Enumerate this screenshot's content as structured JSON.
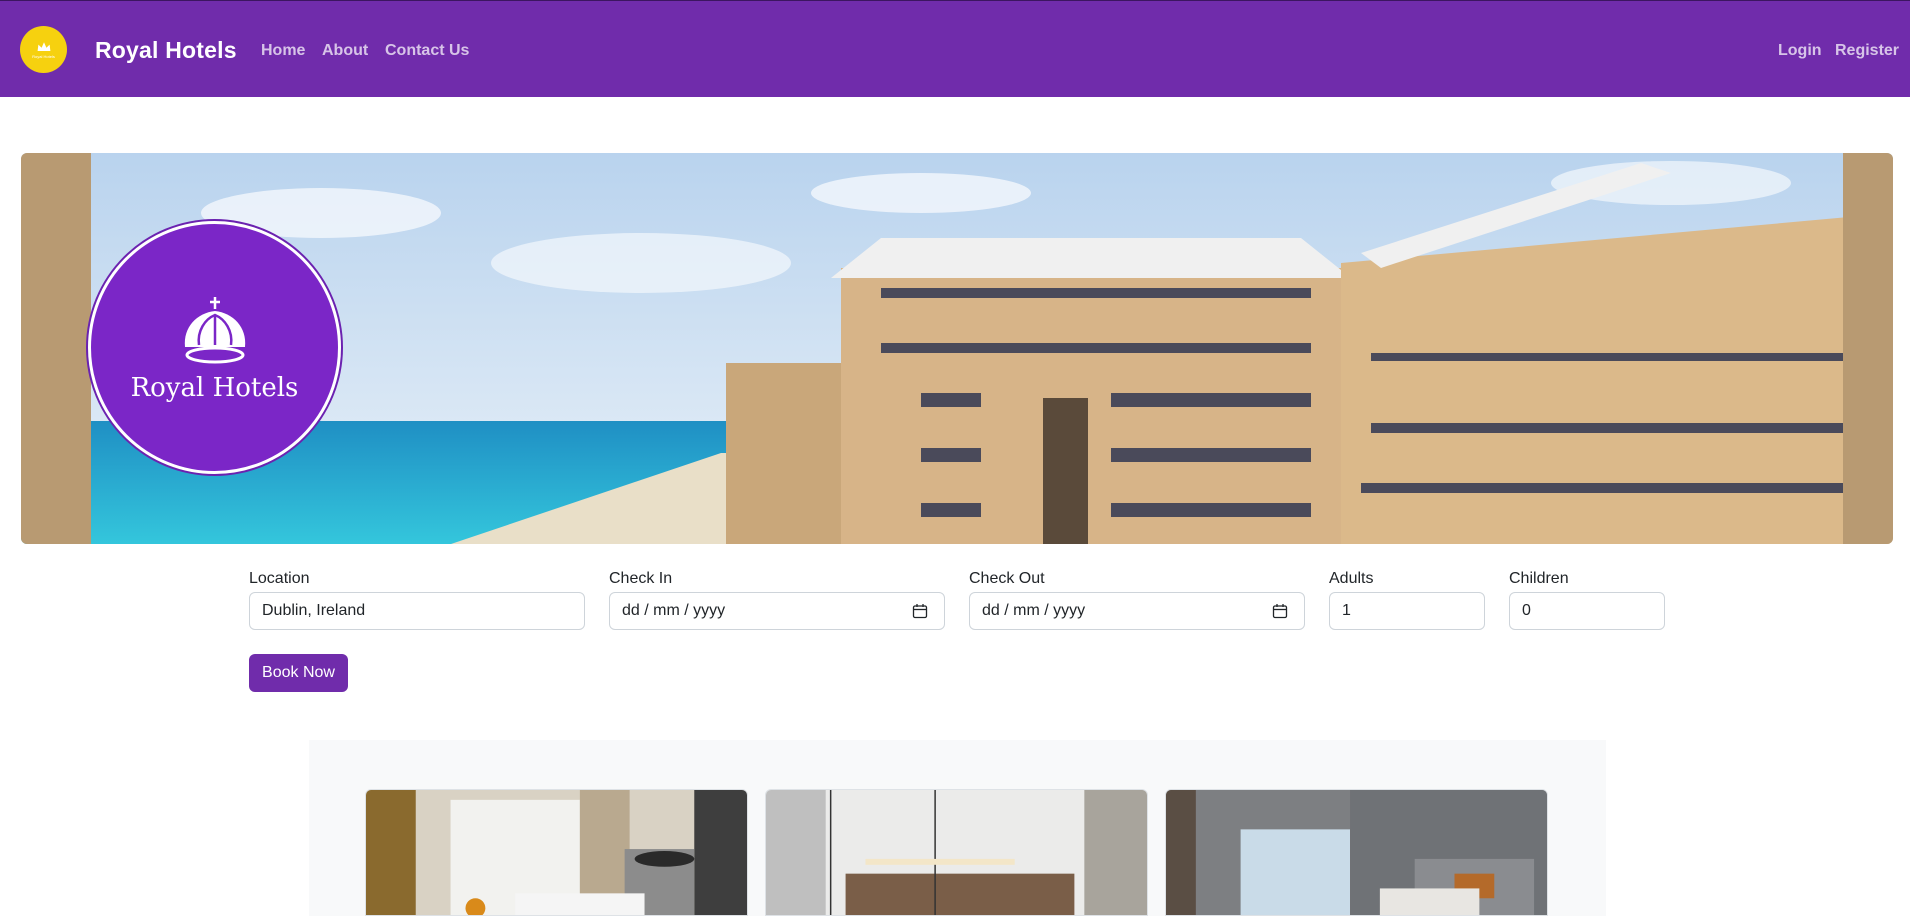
{
  "nav": {
    "logo_text": "Royal Hotels",
    "brand": "Royal Hotels",
    "links": [
      "Home",
      "About",
      "Contact Us"
    ],
    "auth": [
      "Login",
      "Register"
    ]
  },
  "hero": {
    "badge_text": "Royal Hotels"
  },
  "booking": {
    "location": {
      "label": "Location",
      "value": "Dublin, Ireland"
    },
    "check_in": {
      "label": "Check In",
      "placeholder": "dd / mm / yyyy"
    },
    "check_out": {
      "label": "Check Out",
      "placeholder": "dd / mm / yyyy"
    },
    "adults": {
      "label": "Adults",
      "value": "1"
    },
    "children": {
      "label": "Children",
      "value": "0"
    },
    "submit": "Book Now"
  },
  "colors": {
    "primary": "#702cab",
    "logo_yellow": "#f6d10f",
    "badge_purple": "#7b26c7"
  }
}
